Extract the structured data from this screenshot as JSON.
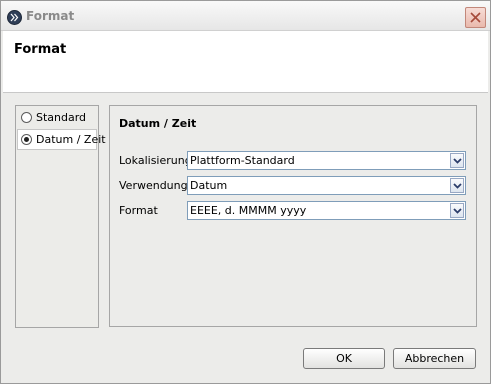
{
  "window": {
    "title": "Format"
  },
  "header": {
    "title": "Format"
  },
  "sidebar": {
    "options": [
      {
        "label": "Standard",
        "selected": false
      },
      {
        "label": "Datum / Zeit",
        "selected": true
      }
    ]
  },
  "panel": {
    "title": "Datum / Zeit",
    "fields": [
      {
        "label": "Lokalisierung",
        "value": "Plattform-Standard"
      },
      {
        "label": "Verwendung",
        "value": "Datum"
      },
      {
        "label": "Format",
        "value": "EEEE, d. MMMM yyyy"
      }
    ]
  },
  "buttons": {
    "ok": "OK",
    "cancel": "Abbrechen"
  },
  "icons": {
    "app": "app-icon",
    "close": "close-icon",
    "dropdown": "chevron-down-icon"
  }
}
